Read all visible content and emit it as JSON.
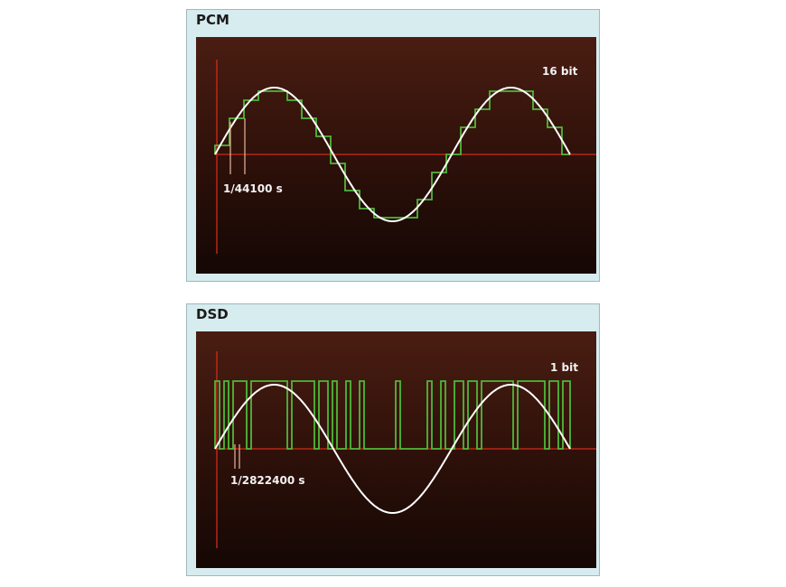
{
  "panels": [
    {
      "title": "PCM",
      "bit_label": "16 bit",
      "interval_label": "1/44100 s"
    },
    {
      "title": "DSD",
      "bit_label": "1 bit",
      "interval_label": "1/2822400 s"
    }
  ],
  "colors": {
    "panel_bg": "#d6ecef",
    "plot_bg_top": "#4a1d12",
    "plot_bg_bottom": "#150704",
    "axis": "#d42a1a",
    "sine": "#ffffff",
    "signal": "#4fb83a",
    "marker": "#e9b89a"
  },
  "icons": []
}
